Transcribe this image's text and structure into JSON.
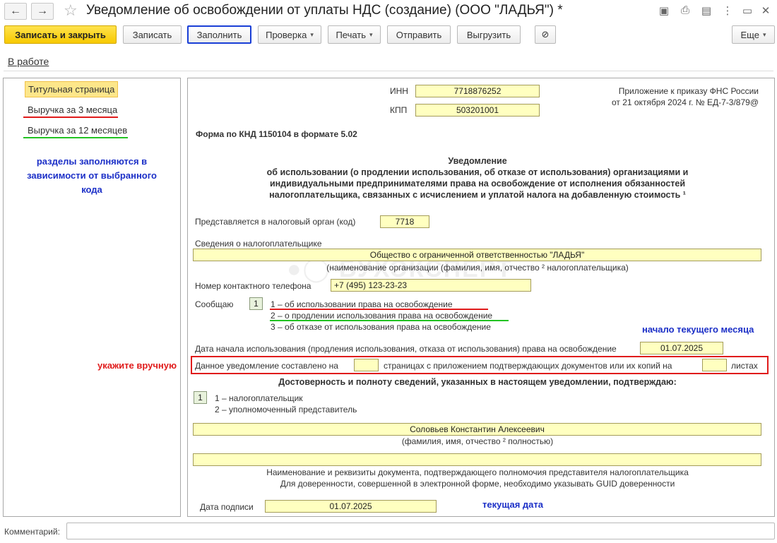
{
  "window": {
    "title": "Уведомление об освобождении от уплаты НДС (создание) (ООО \"ЛАДЬЯ\") *",
    "back_icon": "←",
    "forward_icon": "→",
    "star_icon": "☆",
    "save_icon": "▣",
    "print_icon": "⎙",
    "doc_icon": "▤",
    "menu_icon": "⋮",
    "minimize_icon": "▭",
    "close_icon": "✕"
  },
  "toolbar": {
    "save_close": "Записать и закрыть",
    "save": "Записать",
    "fill": "Заполнить",
    "check": "Проверка",
    "print": "Печать",
    "send": "Отправить",
    "upload": "Выгрузить",
    "attach_icon": "⊘",
    "more": "Еще",
    "caret": "▾"
  },
  "status_link": "В работе",
  "sections": {
    "items": [
      "Титульная страница",
      "Выручка за 3 месяца",
      "Выручка за 12 месяцев"
    ],
    "hint": [
      "разделы заполняются в",
      "зависимости от выбранного",
      "кода"
    ]
  },
  "annotations": {
    "manual": "укажите вручную",
    "month_start": "начало текущего месяца",
    "today": "текущая дата"
  },
  "form": {
    "inn_label": "ИНН",
    "inn": "7718876252",
    "kpp_label": "КПП",
    "kpp": "503201001",
    "appendix_line1": "Приложение к приказу ФНС России",
    "appendix_line2": "от 21 октября 2024 г. № ЕД-7-3/879@",
    "knd": "Форма по КНД 1150104 в формате 5.02",
    "heading": [
      "Уведомление",
      "об использовании (о продлении использования, об отказе от использования) организациями и",
      "индивидуальными предпринимателями права на освобождение от исполнения обязанностей",
      "налогоплательщика, связанных с исчислением и уплатой налога на добавленную стоимость ¹"
    ],
    "tax_office_label": "Представляется в налоговый орган (код)",
    "tax_office": "7718",
    "payer_label": "Сведения о налогоплательщике",
    "org_name": "Общество с ограниченной ответственностью \"ЛАДЬЯ\"",
    "org_caption": "(наименование организации (фамилия, имя, отчество ² налогоплательщика)",
    "phone_label": "Номер контактного телефона",
    "phone": "+7 (495) 123-23-23",
    "report_label": "Сообщаю",
    "report_code": "1",
    "report_options": [
      "1 – об использовании права на освобождение",
      "2 – о продлении использования права на освобождение",
      "3 – об отказе от использования права на освобождение"
    ],
    "start_date_label": "Дата начала использования (продления использования, отказа от использования) права на освобождение",
    "start_date": "01.07.2025",
    "pages_label": "Данное уведомление составлено на",
    "pages_value": "",
    "pages_mid": "страницах с приложением подтверждающих документов или их копий на",
    "sheets_value": "",
    "sheets_label": "листах",
    "confirm_heading": "Достоверность и полноту сведений, указанных в настоящем уведомлении, подтверждаю:",
    "signer_code": "1",
    "signer_options": [
      "1 – налогоплательщик",
      "2 – уполномоченный представитель"
    ],
    "signer_name": "Соловьев Константин Алексеевич",
    "signer_caption": "(фамилия, имя, отчество ² полностью)",
    "rep_doc": "",
    "rep_caption1": "Наименование и реквизиты документа, подтверждающего полномочия представителя налогоплательщика",
    "rep_caption2": "Для доверенности, совершенной в электронной форме, необходимо указывать GUID доверенности",
    "sign_date_label": "Дата подписи",
    "sign_date": "01.07.2025"
  },
  "comment": {
    "label": "Комментарий:",
    "value": ""
  },
  "colors": {
    "primary_button": "#f7c900",
    "field_bg": "#ffffc0",
    "annotation_red": "#e01b1b",
    "annotation_blue": "#1b2fc7",
    "underline_red": "#e01b1b",
    "underline_green": "#22c322"
  }
}
